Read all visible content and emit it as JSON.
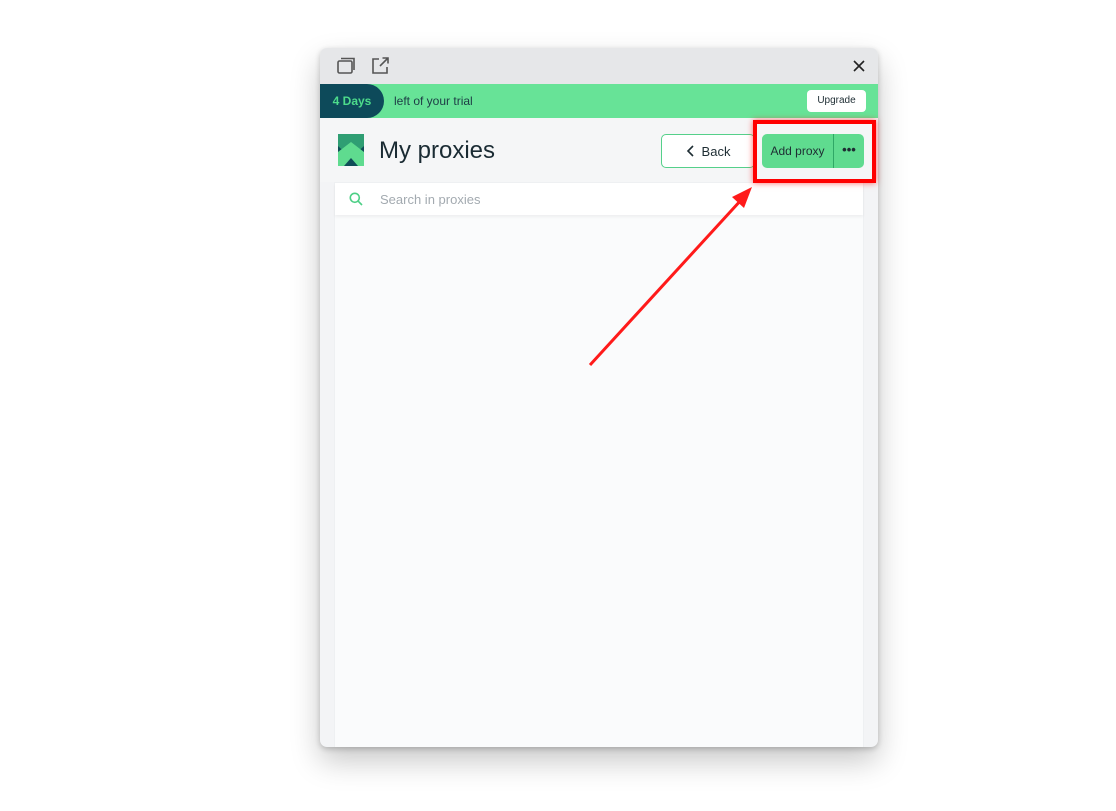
{
  "window": {
    "icons": [
      "window-tab-icon",
      "external-link-icon",
      "close-icon"
    ]
  },
  "trial": {
    "days_label": "4 Days",
    "message": "left of your trial",
    "upgrade_label": "Upgrade"
  },
  "header": {
    "title": "My proxies",
    "back_label": "Back",
    "add_label": "Add proxy",
    "more_label": "•••"
  },
  "search": {
    "placeholder": "Search in proxies",
    "value": ""
  },
  "colors": {
    "brand_green": "#67e397",
    "brand_dark": "#0d4a5a",
    "annotation_red": "#ff0000"
  }
}
